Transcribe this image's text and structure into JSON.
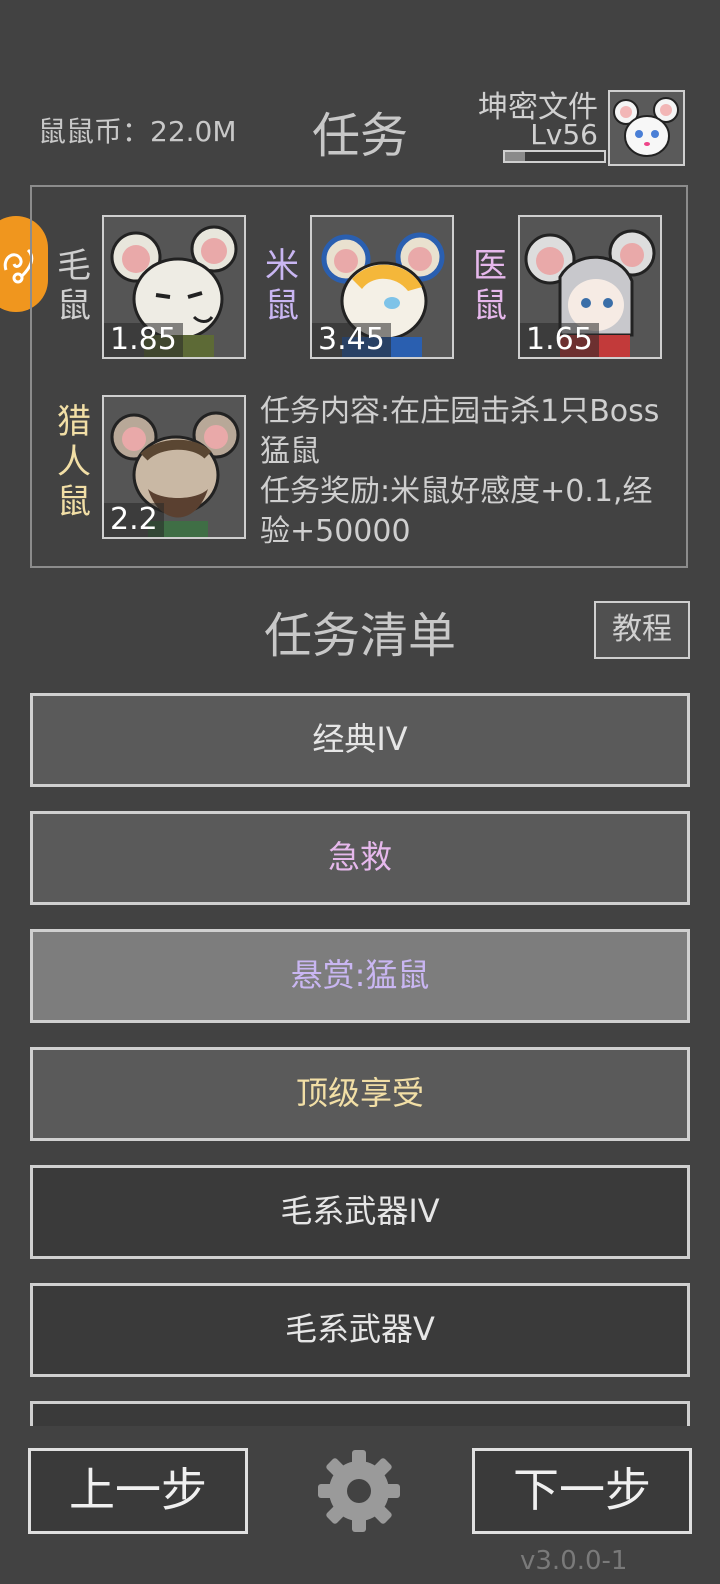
{
  "header": {
    "coins_label": "鼠鼠币：22.0M",
    "title": "任务",
    "profile_name": "坤密文件",
    "level": "Lv56",
    "xp_progress": 0.2
  },
  "team": {
    "members": [
      {
        "name": "毛鼠",
        "value": "1.85",
        "name_color": "#cfcfcf"
      },
      {
        "name": "米鼠",
        "value": "3.45",
        "name_color": "#c9b6f2"
      },
      {
        "name": "医鼠",
        "value": "1.65",
        "name_color": "#e6b8ec"
      },
      {
        "name": "猎人鼠",
        "value": "2.2",
        "name_color": "#f2dfa6"
      }
    ],
    "quest_content": "任务内容:在庄园击杀1只Boss猛鼠",
    "quest_reward": "任务奖励:米鼠好感度+0.1,经验+50000"
  },
  "quest_list": {
    "title": "任务清单",
    "tutorial_label": "教程",
    "items": [
      {
        "label": "经典IV",
        "text_color": "#e6e6e6",
        "bg": "#5a5a5a"
      },
      {
        "label": "急救",
        "text_color": "#e6b8ec",
        "bg": "#5a5a5a"
      },
      {
        "label": "悬赏:猛鼠",
        "text_color": "#c9b6f2",
        "bg": "#7d7d7d"
      },
      {
        "label": "顶级享受",
        "text_color": "#f2dfa6",
        "bg": "#5a5a5a"
      },
      {
        "label": "毛系武器IV",
        "text_color": "#e6e6e6",
        "bg": "#3a3a3a"
      },
      {
        "label": "毛系武器V",
        "text_color": "#e6e6e6",
        "bg": "#3a3a3a"
      },
      {
        "label": "",
        "text_color": "#e6e6e6",
        "bg": "#3a3a3a"
      }
    ]
  },
  "footer": {
    "prev_label": "上一步",
    "next_label": "下一步",
    "settings_icon": "gear-icon",
    "version": "v3.0.0-1"
  },
  "colors": {
    "background": "#424242",
    "badge": "#f0961e"
  }
}
